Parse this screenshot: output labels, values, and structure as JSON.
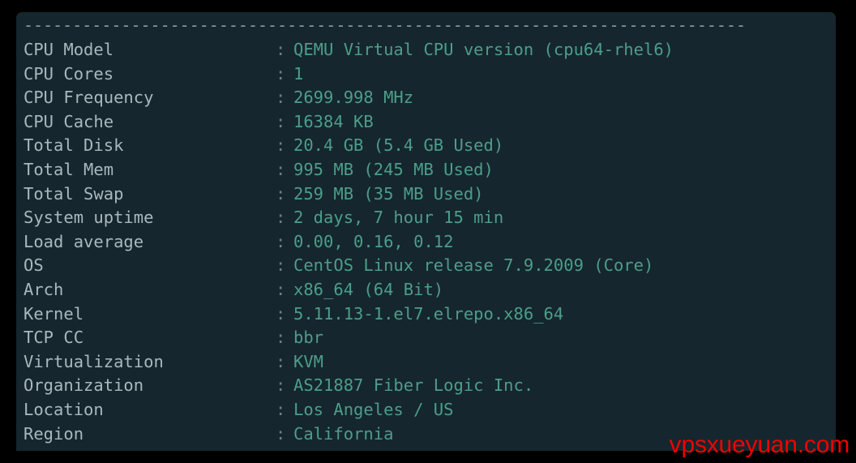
{
  "terminal": {
    "separator_char": "-",
    "separator_top": "--------------------------------------------------------------------------",
    "separator_bottom": "--------------------------------------------------------------------------",
    "colon": ":",
    "colors": {
      "page_background": "#000000",
      "panel_background": "#15262e",
      "label_text": "#aab8bd",
      "colon_text": "#6d8089",
      "value_text": "#4d9d89",
      "separator": "#8a9ba3",
      "watermark": "#f20000"
    },
    "rows": [
      {
        "label": "CPU Model",
        "value": "QEMU Virtual CPU version (cpu64-rhel6)"
      },
      {
        "label": "CPU Cores",
        "value": "1"
      },
      {
        "label": "CPU Frequency",
        "value": "2699.998 MHz"
      },
      {
        "label": "CPU Cache",
        "value": "16384 KB"
      },
      {
        "label": "Total Disk",
        "value": "20.4 GB (5.4 GB Used)"
      },
      {
        "label": "Total Mem",
        "value": "995 MB (245 MB Used)"
      },
      {
        "label": "Total Swap",
        "value": "259 MB (35 MB Used)"
      },
      {
        "label": "System uptime",
        "value": "2 days, 7 hour 15 min"
      },
      {
        "label": "Load average",
        "value": "0.00, 0.16, 0.12"
      },
      {
        "label": "OS",
        "value": "CentOS Linux release 7.9.2009 (Core)"
      },
      {
        "label": "Arch",
        "value": "x86_64 (64 Bit)"
      },
      {
        "label": "Kernel",
        "value": "5.11.13-1.el7.elrepo.x86_64"
      },
      {
        "label": "TCP CC",
        "value": "bbr"
      },
      {
        "label": "Virtualization",
        "value": "KVM"
      },
      {
        "label": "Organization",
        "value": "AS21887 Fiber Logic Inc."
      },
      {
        "label": "Location",
        "value": "Los Angeles / US"
      },
      {
        "label": "Region",
        "value": "California"
      }
    ]
  },
  "watermark": {
    "text": "vpsxueyuan.com"
  }
}
